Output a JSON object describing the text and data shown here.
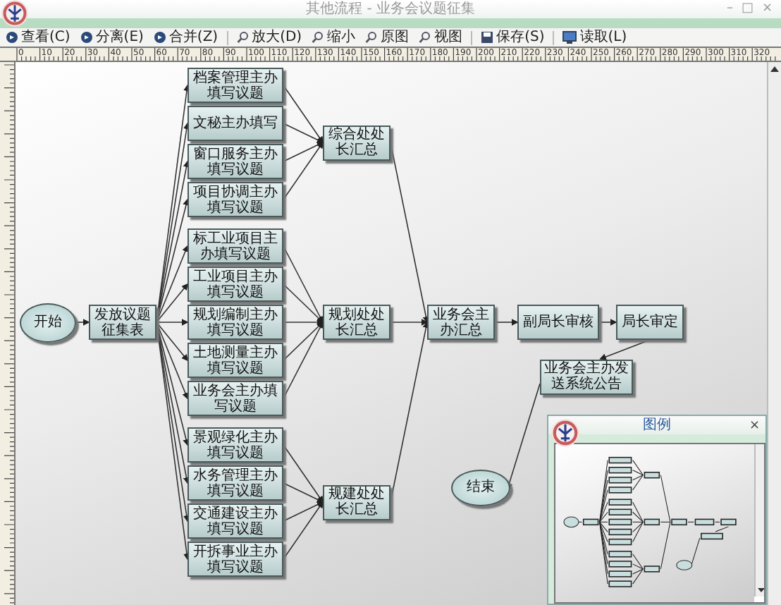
{
  "window": {
    "title": "其他流程 - 业务会议题征集",
    "controls": [
      "–",
      "□",
      "×"
    ]
  },
  "toolbar": [
    {
      "label": "查看(C)",
      "kind": "circle"
    },
    {
      "label": "分离(E)",
      "kind": "circle"
    },
    {
      "label": "合并(Z)",
      "kind": "circle"
    },
    {
      "label": "放大(D)",
      "kind": "zoom"
    },
    {
      "label": "缩小",
      "kind": "zoom"
    },
    {
      "label": "原图",
      "kind": "zoom"
    },
    {
      "label": "视图",
      "kind": "zoom"
    },
    {
      "label": "保存(S)",
      "kind": "save"
    },
    {
      "label": "读取(L)",
      "kind": "monitor"
    }
  ],
  "ruler": {
    "top_labels": [
      "0",
      "10",
      "20",
      "30",
      "40",
      "50",
      "60",
      "70",
      "80",
      "90",
      "100",
      "110",
      "120",
      "130",
      "140",
      "150",
      "160",
      "170",
      "180",
      "190",
      "200",
      "210",
      "220",
      "230",
      "240",
      "250",
      "260",
      "270",
      "280",
      "290",
      "300",
      "310",
      "320"
    ]
  },
  "diagram": {
    "start": "开始",
    "dispatch": "发放议题征集表",
    "groups": [
      {
        "summary": "综合处处长汇总",
        "tasks": [
          "档案管理主办填写议题",
          "文秘主办填写",
          "窗口服务主办填写议题",
          "项目协调主办填写议题"
        ]
      },
      {
        "summary": "规划处处长汇总",
        "tasks": [
          "标工业项目主办填写议题",
          "工业项目主办填写议题",
          "规划编制主办填写议题",
          "土地测量主办填写议题",
          "业务会主办填写议题"
        ]
      },
      {
        "summary": "规建处处长汇总",
        "tasks": [
          "景观绿化主办填写议题",
          "水务管理主办填写议题",
          "交通建设主办填写议题",
          "开拆事业主办填写议题"
        ]
      }
    ],
    "chain": [
      "业务会主办汇总",
      "副局长审核",
      "局长审定"
    ],
    "notify": "业务会主办发送系统公告",
    "end": "结束"
  },
  "legend_window": {
    "title": "图例",
    "close": "×"
  }
}
